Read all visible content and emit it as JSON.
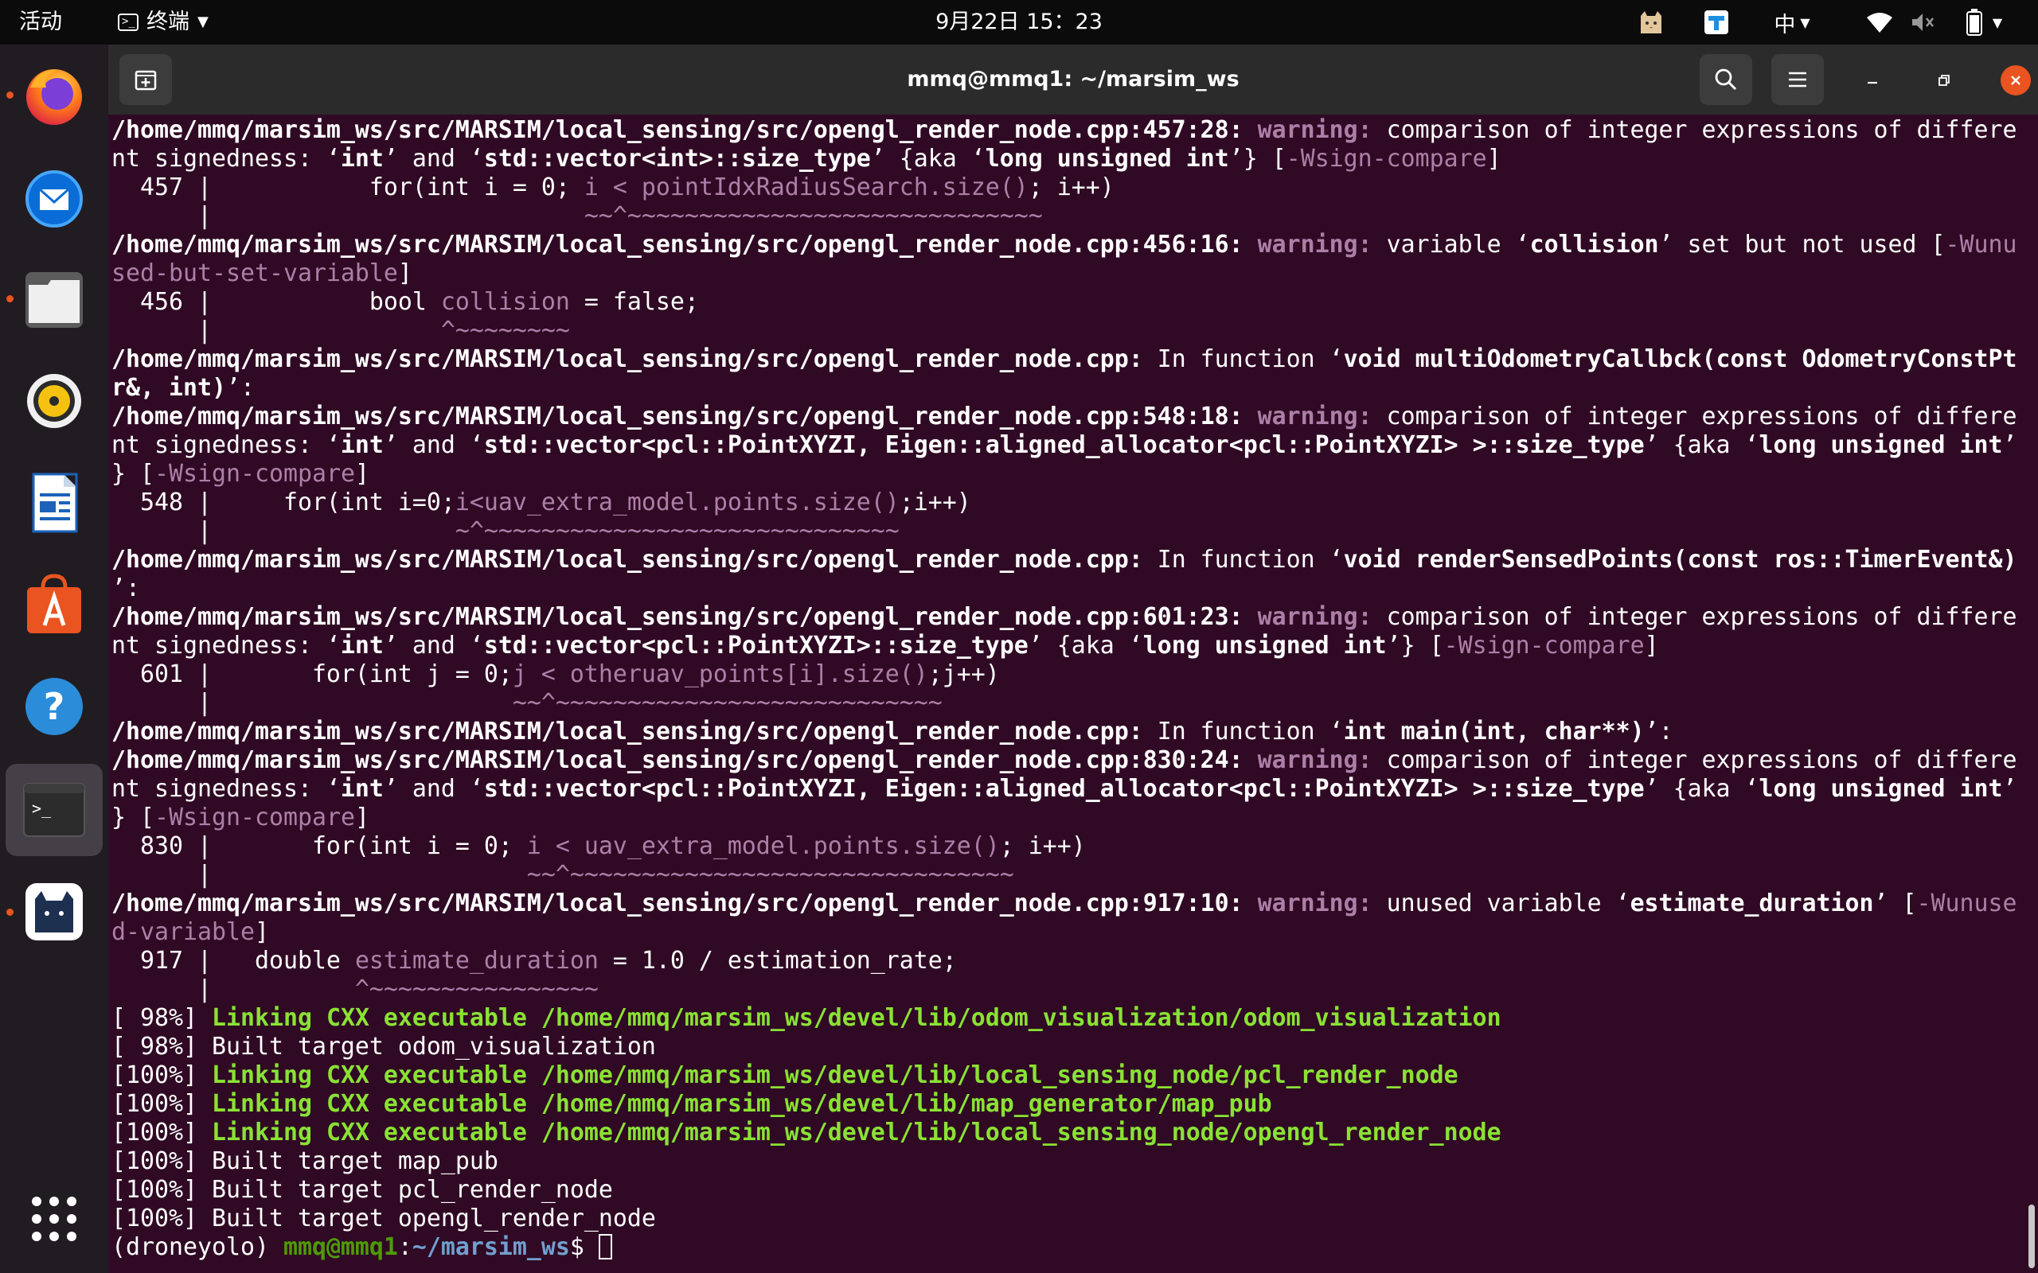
{
  "topbar": {
    "activities": "活动",
    "app_menu": "终端",
    "clock": "9月22日 15：23",
    "input_method": "中"
  },
  "dock": {
    "items": [
      {
        "name": "firefox",
        "running": true
      },
      {
        "name": "thunderbird",
        "running": false
      },
      {
        "name": "files",
        "running": true
      },
      {
        "name": "rhythmbox",
        "running": false
      },
      {
        "name": "writer",
        "running": false
      },
      {
        "name": "software",
        "running": false
      },
      {
        "name": "help",
        "running": false
      },
      {
        "name": "terminal",
        "running": true
      },
      {
        "name": "cat-app",
        "running": true
      }
    ]
  },
  "window": {
    "title": "mmq@mmq1: ~/marsim_ws"
  },
  "terminal": {
    "lines": [
      [
        {
          "c": "b",
          "t": "/home/mmq/marsim_ws/src/MARSIM/local_sensing/src/opengl_render_node.cpp:457:28: "
        },
        {
          "c": "w",
          "t": "warning: "
        },
        {
          "t": "comparison of integer expressions of differe"
        }
      ],
      [
        {
          "t": "nt signedness: ‘"
        },
        {
          "c": "b",
          "t": "int"
        },
        {
          "t": "’ and ‘"
        },
        {
          "c": "b",
          "t": "std::vector<int>::size_type"
        },
        {
          "t": "’ {aka ‘"
        },
        {
          "c": "b",
          "t": "long unsigned int"
        },
        {
          "t": "’} ["
        },
        {
          "c": "f",
          "t": "-Wsign-compare"
        },
        {
          "t": "]"
        }
      ],
      [
        {
          "t": "  457 |           for(int i = 0; "
        },
        {
          "c": "f",
          "t": "i < pointIdxRadiusSearch.size()"
        },
        {
          "t": "; i++)"
        }
      ],
      [
        {
          "t": "      |                          "
        },
        {
          "c": "f",
          "t": "~~^~~~~~~~~~~~~~~~~~~~~~~~~~~~~~"
        }
      ],
      [
        {
          "c": "b",
          "t": "/home/mmq/marsim_ws/src/MARSIM/local_sensing/src/opengl_render_node.cpp:456:16: "
        },
        {
          "c": "w",
          "t": "warning: "
        },
        {
          "t": "variable ‘"
        },
        {
          "c": "b",
          "t": "collision"
        },
        {
          "t": "’ set but not used ["
        },
        {
          "c": "f",
          "t": "-Wunu"
        }
      ],
      [
        {
          "c": "f",
          "t": "sed-but-set-variable"
        },
        {
          "t": "]"
        }
      ],
      [
        {
          "t": "  456 |           bool "
        },
        {
          "c": "f",
          "t": "collision"
        },
        {
          "t": " = false;"
        }
      ],
      [
        {
          "t": "      |                "
        },
        {
          "c": "f",
          "t": "^~~~~~~~~"
        }
      ],
      [
        {
          "c": "b",
          "t": "/home/mmq/marsim_ws/src/MARSIM/local_sensing/src/opengl_render_node.cpp:"
        },
        {
          "t": " In function ‘"
        },
        {
          "c": "b",
          "t": "void multiOdometryCallbck(const OdometryConstPt"
        }
      ],
      [
        {
          "c": "b",
          "t": "r&, int)"
        },
        {
          "t": "’:"
        }
      ],
      [
        {
          "c": "b",
          "t": "/home/mmq/marsim_ws/src/MARSIM/local_sensing/src/opengl_render_node.cpp:548:18: "
        },
        {
          "c": "w",
          "t": "warning: "
        },
        {
          "t": "comparison of integer expressions of differe"
        }
      ],
      [
        {
          "t": "nt signedness: ‘"
        },
        {
          "c": "b",
          "t": "int"
        },
        {
          "t": "’ and ‘"
        },
        {
          "c": "b",
          "t": "std::vector<pcl::PointXYZI, Eigen::aligned_allocator<pcl::PointXYZI> >::size_type"
        },
        {
          "t": "’ {aka ‘"
        },
        {
          "c": "b",
          "t": "long unsigned int"
        },
        {
          "t": "’"
        }
      ],
      [
        {
          "t": "} ["
        },
        {
          "c": "f",
          "t": "-Wsign-compare"
        },
        {
          "t": "]"
        }
      ],
      [
        {
          "t": "  548 |     for(int i=0;"
        },
        {
          "c": "f",
          "t": "i<uav_extra_model.points.size()"
        },
        {
          "t": ";i++)"
        }
      ],
      [
        {
          "t": "      |                 "
        },
        {
          "c": "f",
          "t": "~^~~~~~~~~~~~~~~~~~~~~~~~~~~~~~"
        }
      ],
      [
        {
          "c": "b",
          "t": "/home/mmq/marsim_ws/src/MARSIM/local_sensing/src/opengl_render_node.cpp:"
        },
        {
          "t": " In function ‘"
        },
        {
          "c": "b",
          "t": "void renderSensedPoints(const ros::TimerEvent&)"
        }
      ],
      [
        {
          "t": "’:"
        }
      ],
      [
        {
          "c": "b",
          "t": "/home/mmq/marsim_ws/src/MARSIM/local_sensing/src/opengl_render_node.cpp:601:23: "
        },
        {
          "c": "w",
          "t": "warning: "
        },
        {
          "t": "comparison of integer expressions of differe"
        }
      ],
      [
        {
          "t": "nt signedness: ‘"
        },
        {
          "c": "b",
          "t": "int"
        },
        {
          "t": "’ and ‘"
        },
        {
          "c": "b",
          "t": "std::vector<pcl::PointXYZI>::size_type"
        },
        {
          "t": "’ {aka ‘"
        },
        {
          "c": "b",
          "t": "long unsigned int"
        },
        {
          "t": "’} ["
        },
        {
          "c": "f",
          "t": "-Wsign-compare"
        },
        {
          "t": "]"
        }
      ],
      [
        {
          "t": "  601 |       for(int j = 0;"
        },
        {
          "c": "f",
          "t": "j < otheruav_points[i].size()"
        },
        {
          "t": ";j++)"
        }
      ],
      [
        {
          "t": "      |                     "
        },
        {
          "c": "f",
          "t": "~~^~~~~~~~~~~~~~~~~~~~~~~~~~~~"
        }
      ],
      [
        {
          "c": "b",
          "t": "/home/mmq/marsim_ws/src/MARSIM/local_sensing/src/opengl_render_node.cpp:"
        },
        {
          "t": " In function ‘"
        },
        {
          "c": "b",
          "t": "int main(int, char**)"
        },
        {
          "t": "’:"
        }
      ],
      [
        {
          "c": "b",
          "t": "/home/mmq/marsim_ws/src/MARSIM/local_sensing/src/opengl_render_node.cpp:830:24: "
        },
        {
          "c": "w",
          "t": "warning: "
        },
        {
          "t": "comparison of integer expressions of differe"
        }
      ],
      [
        {
          "t": "nt signedness: ‘"
        },
        {
          "c": "b",
          "t": "int"
        },
        {
          "t": "’ and ‘"
        },
        {
          "c": "b",
          "t": "std::vector<pcl::PointXYZI, Eigen::aligned_allocator<pcl::PointXYZI> >::size_type"
        },
        {
          "t": "’ {aka ‘"
        },
        {
          "c": "b",
          "t": "long unsigned int"
        },
        {
          "t": "’"
        }
      ],
      [
        {
          "t": "} ["
        },
        {
          "c": "f",
          "t": "-Wsign-compare"
        },
        {
          "t": "]"
        }
      ],
      [
        {
          "t": "  830 |       for(int i = 0; "
        },
        {
          "c": "f",
          "t": "i < uav_extra_model.points.size()"
        },
        {
          "t": "; i++)"
        }
      ],
      [
        {
          "t": "      |                      "
        },
        {
          "c": "f",
          "t": "~~^~~~~~~~~~~~~~~~~~~~~~~~~~~~~~~~"
        }
      ],
      [
        {
          "c": "b",
          "t": "/home/mmq/marsim_ws/src/MARSIM/local_sensing/src/opengl_render_node.cpp:917:10: "
        },
        {
          "c": "w",
          "t": "warning: "
        },
        {
          "t": "unused variable ‘"
        },
        {
          "c": "b",
          "t": "estimate_duration"
        },
        {
          "t": "’ ["
        },
        {
          "c": "f",
          "t": "-Wunuse"
        }
      ],
      [
        {
          "c": "f",
          "t": "d-variable"
        },
        {
          "t": "]"
        }
      ],
      [
        {
          "t": "  917 |   double "
        },
        {
          "c": "f",
          "t": "estimate_duration"
        },
        {
          "t": " = 1.0 / estimation_rate;"
        }
      ],
      [
        {
          "t": "      |          "
        },
        {
          "c": "f",
          "t": "^~~~~~~~~~~~~~~~~"
        }
      ],
      [
        {
          "t": "[ 98%] "
        },
        {
          "c": "g",
          "t": "Linking CXX executable /home/mmq/marsim_ws/devel/lib/odom_visualization/odom_visualization"
        }
      ],
      [
        {
          "t": "[ 98%] Built target odom_visualization"
        }
      ],
      [
        {
          "t": "[100%] "
        },
        {
          "c": "g",
          "t": "Linking CXX executable /home/mmq/marsim_ws/devel/lib/local_sensing_node/pcl_render_node"
        }
      ],
      [
        {
          "t": "[100%] "
        },
        {
          "c": "g",
          "t": "Linking CXX executable /home/mmq/marsim_ws/devel/lib/map_generator/map_pub"
        }
      ],
      [
        {
          "t": "[100%] "
        },
        {
          "c": "g",
          "t": "Linking CXX executable /home/mmq/marsim_ws/devel/lib/local_sensing_node/opengl_render_node"
        }
      ],
      [
        {
          "t": "[100%] Built target map_pub"
        }
      ],
      [
        {
          "t": "[100%] Built target pcl_render_node"
        }
      ],
      [
        {
          "t": "[100%] Built target opengl_render_node"
        }
      ]
    ],
    "prompt": {
      "env": "(droneyolo) ",
      "user_host": "mmq@mmq1",
      "sep": ":",
      "path": "~/marsim_ws",
      "symbol": "$ "
    }
  }
}
